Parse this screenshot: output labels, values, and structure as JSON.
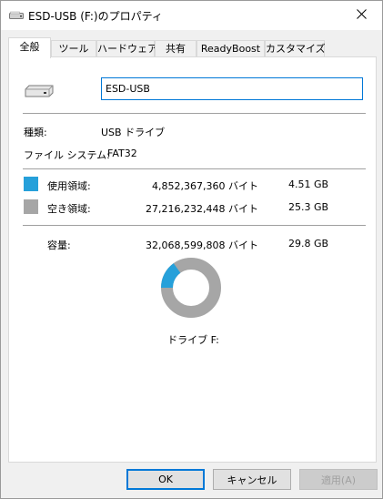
{
  "window": {
    "title": "ESD-USB (F:)のプロパティ",
    "close_icon": "close-icon"
  },
  "tabs": [
    {
      "label": "全般",
      "active": true
    },
    {
      "label": "ツール",
      "active": false
    },
    {
      "label": "ハードウェア",
      "active": false
    },
    {
      "label": "共有",
      "active": false
    },
    {
      "label": "ReadyBoost",
      "active": false
    },
    {
      "label": "カスタマイズ",
      "active": false
    }
  ],
  "general": {
    "drive_name": "ESD-USB",
    "type_label": "種類:",
    "type_value": "USB ドライブ",
    "fs_label": "ファイル システム:",
    "fs_value": "FAT32",
    "used": {
      "label": "使用領域:",
      "bytes": "4,852,367,360 バイト",
      "size": "4.51 GB",
      "color": "#26a0da"
    },
    "free": {
      "label": "空き領域:",
      "bytes": "27,216,232,448 バイト",
      "size": "25.3 GB",
      "color": "#a6a6a6"
    },
    "capacity": {
      "label": "容量:",
      "bytes": "32,068,599,808 バイト",
      "size": "29.8 GB"
    },
    "used_fraction": 0.151,
    "drive_label": "ドライブ F:"
  },
  "buttons": {
    "ok": "OK",
    "cancel": "キャンセル",
    "apply": "適用(A)"
  }
}
